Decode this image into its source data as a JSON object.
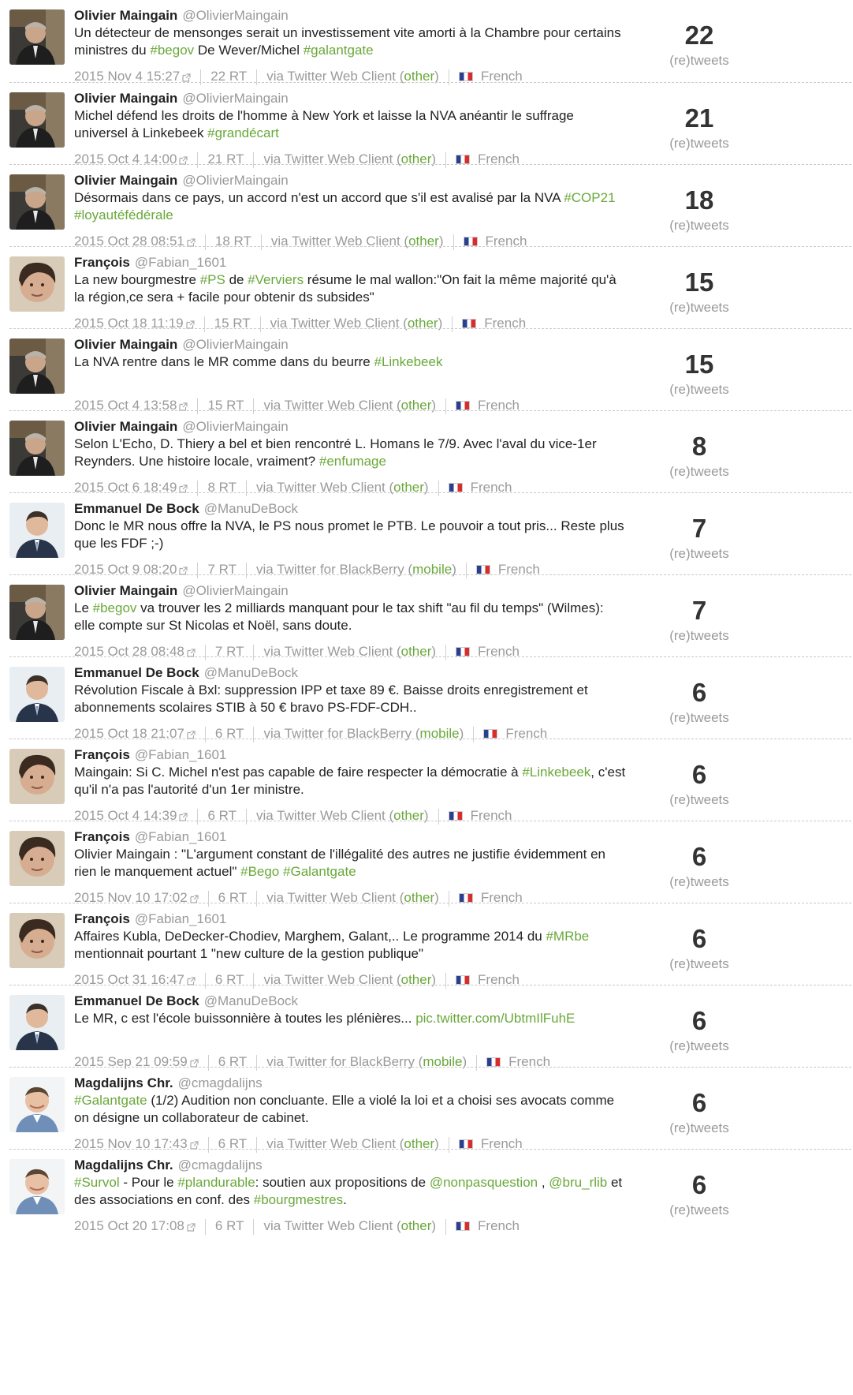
{
  "retweets_label": "(re)tweets",
  "rt_suffix": "RT",
  "via_prefix": "via",
  "colors": {
    "accent": "#6aa83a",
    "muted": "#9a9a9a",
    "text": "#222222"
  },
  "icons": {
    "external_link": "external-link-icon",
    "language_flag": "france-flag-icon"
  },
  "tweets": [
    {
      "name": "Olivier Maingain",
      "handle": "@OlivierMaingain",
      "avatar": "maingain",
      "segments": [
        {
          "t": "Un détecteur de mensonges serait un investissement vite amorti à la Chambre pour certains ministres du "
        },
        {
          "t": "#begov",
          "tag": true
        },
        {
          "t": " De Wever/Michel "
        },
        {
          "t": "#galantgate",
          "tag": true
        }
      ],
      "date": "2015 Nov 4 15:27",
      "rt": "22",
      "client": "Twitter Web Client",
      "client_type": "other",
      "lang": "French",
      "count": "22"
    },
    {
      "name": "Olivier Maingain",
      "handle": "@OlivierMaingain",
      "avatar": "maingain",
      "segments": [
        {
          "t": "Michel défend les droits de l'homme à New York et laisse la NVA anéantir le suffrage universel à Linkebeek "
        },
        {
          "t": "#grandécart",
          "tag": true
        }
      ],
      "date": "2015 Oct 4 14:00",
      "rt": "21",
      "client": "Twitter Web Client",
      "client_type": "other",
      "lang": "French",
      "count": "21"
    },
    {
      "name": "Olivier Maingain",
      "handle": "@OlivierMaingain",
      "avatar": "maingain",
      "segments": [
        {
          "t": "Désormais dans ce pays, un accord n'est un accord que s'il est avalisé par la NVA "
        },
        {
          "t": "#COP21",
          "tag": true
        },
        {
          "t": " "
        },
        {
          "t": "#loyautéfédérale",
          "tag": true
        }
      ],
      "date": "2015 Oct 28 08:51",
      "rt": "18",
      "client": "Twitter Web Client",
      "client_type": "other",
      "lang": "French",
      "count": "18"
    },
    {
      "name": "François",
      "handle": "@Fabian_1601",
      "avatar": "francois",
      "segments": [
        {
          "t": "La new bourgmestre "
        },
        {
          "t": "#PS",
          "tag": true
        },
        {
          "t": " de "
        },
        {
          "t": "#Verviers",
          "tag": true
        },
        {
          "t": " résume le mal wallon:\"On fait la même majorité qu'à la région,ce sera + facile pour obtenir ds subsides\""
        }
      ],
      "date": "2015 Oct 18 11:19",
      "rt": "15",
      "client": "Twitter Web Client",
      "client_type": "other",
      "lang": "French",
      "count": "15"
    },
    {
      "name": "Olivier Maingain",
      "handle": "@OlivierMaingain",
      "avatar": "maingain",
      "segments": [
        {
          "t": "La NVA rentre dans le MR comme dans du beurre "
        },
        {
          "t": "#Linkebeek",
          "tag": true
        }
      ],
      "date": "2015 Oct 4 13:58",
      "rt": "15",
      "client": "Twitter Web Client",
      "client_type": "other",
      "lang": "French",
      "count": "15"
    },
    {
      "name": "Olivier Maingain",
      "handle": "@OlivierMaingain",
      "avatar": "maingain",
      "segments": [
        {
          "t": "Selon L'Echo, D. Thiery a bel et bien rencontré L. Homans le 7/9. Avec l'aval du vice-1er Reynders. Une histoire locale, vraiment? "
        },
        {
          "t": "#enfumage",
          "tag": true
        }
      ],
      "date": "2015 Oct 6 18:49",
      "rt": "8",
      "client": "Twitter Web Client",
      "client_type": "other",
      "lang": "French",
      "count": "8"
    },
    {
      "name": "Emmanuel De Bock",
      "handle": "@ManuDeBock",
      "avatar": "debock",
      "segments": [
        {
          "t": "Donc le MR nous offre la NVA, le PS nous promet le PTB. Le pouvoir a tout pris... Reste plus que les FDF ;-)"
        }
      ],
      "date": "2015 Oct 9 08:20",
      "rt": "7",
      "client": "Twitter for BlackBerry",
      "client_type": "mobile",
      "lang": "French",
      "count": "7"
    },
    {
      "name": "Olivier Maingain",
      "handle": "@OlivierMaingain",
      "avatar": "maingain",
      "segments": [
        {
          "t": "Le "
        },
        {
          "t": "#begov",
          "tag": true
        },
        {
          "t": " va trouver les 2 milliards manquant pour le tax shift \"au fil du temps\" (Wilmes): elle compte sur St Nicolas et Noël, sans doute."
        }
      ],
      "date": "2015 Oct 28 08:48",
      "rt": "7",
      "client": "Twitter Web Client",
      "client_type": "other",
      "lang": "French",
      "count": "7"
    },
    {
      "name": "Emmanuel De Bock",
      "handle": "@ManuDeBock",
      "avatar": "debock",
      "segments": [
        {
          "t": "Révolution Fiscale à Bxl: suppression IPP et taxe 89 €. Baisse droits enregistrement et abonnements scolaires STIB à 50 € bravo PS-FDF-CDH.."
        }
      ],
      "date": "2015 Oct 18 21:07",
      "rt": "6",
      "client": "Twitter for BlackBerry",
      "client_type": "mobile",
      "lang": "French",
      "count": "6"
    },
    {
      "name": "François",
      "handle": "@Fabian_1601",
      "avatar": "francois",
      "segments": [
        {
          "t": "Maingain: Si C. Michel n'est pas capable de faire respecter la démocratie à "
        },
        {
          "t": "#Linkebeek",
          "tag": true
        },
        {
          "t": ", c'est qu'il n'a pas l'autorité d'un 1er ministre."
        }
      ],
      "date": "2015 Oct 4 14:39",
      "rt": "6",
      "client": "Twitter Web Client",
      "client_type": "other",
      "lang": "French",
      "count": "6"
    },
    {
      "name": "François",
      "handle": "@Fabian_1601",
      "avatar": "francois",
      "segments": [
        {
          "t": "Olivier Maingain : \"L'argument constant de l'illégalité des autres ne justifie évidemment en rien le manquement actuel\" "
        },
        {
          "t": "#Bego",
          "tag": true
        },
        {
          "t": " "
        },
        {
          "t": "#Galantgate",
          "tag": true
        }
      ],
      "date": "2015 Nov 10 17:02",
      "rt": "6",
      "client": "Twitter Web Client",
      "client_type": "other",
      "lang": "French",
      "count": "6"
    },
    {
      "name": "François",
      "handle": "@Fabian_1601",
      "avatar": "francois",
      "segments": [
        {
          "t": "Affaires Kubla, DeDecker-Chodiev, Marghem, Galant,.. Le programme 2014 du "
        },
        {
          "t": "#MRbe",
          "tag": true
        },
        {
          "t": " mentionnait pourtant 1 \"new culture de la gestion publique\""
        }
      ],
      "date": "2015 Oct 31 16:47",
      "rt": "6",
      "client": "Twitter Web Client",
      "client_type": "other",
      "lang": "French",
      "count": "6"
    },
    {
      "name": "Emmanuel De Bock",
      "handle": "@ManuDeBock",
      "avatar": "debock",
      "segments": [
        {
          "t": "Le MR, c est l'école buissonnière à toutes les plénières... "
        },
        {
          "t": "pic.twitter.com/UbtmIlFuhE",
          "tag": true
        }
      ],
      "date": "2015 Sep 21 09:59",
      "rt": "6",
      "client": "Twitter for BlackBerry",
      "client_type": "mobile",
      "lang": "French",
      "count": "6"
    },
    {
      "name": "Magdalijns Chr.",
      "handle": "@cmagdalijns",
      "avatar": "magdalijns",
      "segments": [
        {
          "t": "#Galantgate",
          "tag": true
        },
        {
          "t": " (1/2) Audition non concluante. Elle a violé la loi et a choisi ses avocats comme on désigne un collaborateur de cabinet."
        }
      ],
      "date": "2015 Nov 10 17:43",
      "rt": "6",
      "client": "Twitter Web Client",
      "client_type": "other",
      "lang": "French",
      "count": "6"
    },
    {
      "name": "Magdalijns Chr.",
      "handle": "@cmagdalijns",
      "avatar": "magdalijns",
      "segments": [
        {
          "t": "#Survol",
          "tag": true
        },
        {
          "t": " - Pour le "
        },
        {
          "t": "#plandurable",
          "tag": true
        },
        {
          "t": ": soutien aux propositions de "
        },
        {
          "t": "@nonpasquestion",
          "tag": true
        },
        {
          "t": " , "
        },
        {
          "t": "@bru_rlib",
          "tag": true
        },
        {
          "t": " et des associations en conf. des "
        },
        {
          "t": "#bourgmestres",
          "tag": true
        },
        {
          "t": "."
        }
      ],
      "date": "2015 Oct 20 17:08",
      "rt": "6",
      "client": "Twitter Web Client",
      "client_type": "other",
      "lang": "French",
      "count": "6"
    }
  ]
}
